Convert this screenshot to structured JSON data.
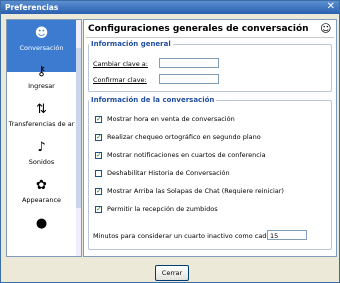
{
  "window": {
    "title": "Preferencias",
    "close_glyph": "✕"
  },
  "sidebar": {
    "items": [
      {
        "label": "Conversación",
        "icon": "conversation-icon",
        "glyph": "☻",
        "selected": true
      },
      {
        "label": "Ingresar",
        "icon": "key-icon",
        "glyph": "⚷",
        "selected": false
      },
      {
        "label": "Transferencias de ar",
        "icon": "transfer-icon",
        "glyph": "⇅",
        "selected": false
      },
      {
        "label": "Sonidos",
        "icon": "sounds-icon",
        "glyph": "♪",
        "selected": false
      },
      {
        "label": "Appearance",
        "icon": "appearance-icon",
        "glyph": "✿",
        "selected": false
      },
      {
        "label": "",
        "icon": "info-icon",
        "glyph": "●",
        "selected": false
      }
    ]
  },
  "main": {
    "title": "Configuraciones generales de conversación",
    "general": {
      "legend": "Información general",
      "change_password": "Cambiar clave a:",
      "confirm_password": "Confirmar clave:",
      "change_value": "",
      "confirm_value": ""
    },
    "conversation": {
      "legend": "Información de la conversación",
      "options": [
        {
          "label": "Mostrar hora en venta de conversación",
          "checked": true
        },
        {
          "label": "Realizar chequeo ortográfico en segundo plano",
          "checked": true
        },
        {
          "label": "Mostrar notificaciones en cuartos de conferencia",
          "checked": true
        },
        {
          "label": "Deshabilitar Historia de Conversación",
          "checked": false
        },
        {
          "label": "Mostrar Arriba las Solapas de Chat (Requiere reiniciar)",
          "checked": true
        },
        {
          "label": "Permitir la recepción de zumbidos",
          "checked": true
        }
      ],
      "inactive_label": "Minutos para considerar un cuarto inactivo como caducado:",
      "inactive_value": "15"
    }
  },
  "footer": {
    "close_button": "Cerrar"
  },
  "colors": {
    "selection": "#3d7bd1",
    "legend": "#224f9e",
    "titlebar": "#2a5fb0"
  }
}
